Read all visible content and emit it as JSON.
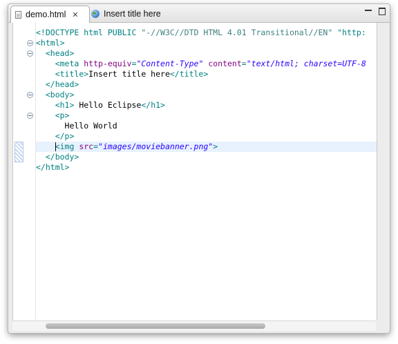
{
  "tabs": [
    {
      "label": "demo.html",
      "icon": "html-file-icon",
      "active": true,
      "close_icon": "close-icon"
    },
    {
      "label": "Insert title here",
      "icon": "globe-icon",
      "active": false
    }
  ],
  "window_controls": [
    "minimize-icon",
    "maximize-icon"
  ],
  "editor": {
    "lines": [
      {
        "segments": [
          [
            "doctype",
            "<!DOCTYPE html PUBLIC "
          ],
          [
            "dtstr",
            "\"-//W3C//DTD HTML 4.01 Transitional//EN\""
          ],
          [
            "doctype",
            " \"http:"
          ]
        ]
      },
      {
        "segments": [
          [
            "tag",
            "<html>"
          ]
        ],
        "fold": true
      },
      {
        "segments": [
          [
            "t",
            "  "
          ],
          [
            "tag",
            "<head>"
          ]
        ],
        "fold": true
      },
      {
        "segments": [
          [
            "t",
            "    "
          ],
          [
            "tag",
            "<meta "
          ],
          [
            "attr",
            "http-equiv"
          ],
          [
            "tag",
            "="
          ],
          [
            "val",
            "\"Content-Type\""
          ],
          [
            "t",
            " "
          ],
          [
            "attr",
            "content"
          ],
          [
            "tag",
            "="
          ],
          [
            "val",
            "\"text/html; charset=UTF-8"
          ]
        ]
      },
      {
        "segments": [
          [
            "t",
            "    "
          ],
          [
            "tag",
            "<title>"
          ],
          [
            "t",
            "Insert title here"
          ],
          [
            "tag",
            "</title>"
          ]
        ]
      },
      {
        "segments": [
          [
            "t",
            "  "
          ],
          [
            "tag",
            "</head>"
          ]
        ]
      },
      {
        "segments": [
          [
            "t",
            "  "
          ],
          [
            "tag",
            "<body>"
          ]
        ],
        "fold": true
      },
      {
        "segments": [
          [
            "t",
            "    "
          ],
          [
            "tag",
            "<h1>"
          ],
          [
            "t",
            " Hello Eclipse"
          ],
          [
            "tag",
            "</h1>"
          ]
        ]
      },
      {
        "segments": [
          [
            "t",
            "    "
          ],
          [
            "tag",
            "<p>"
          ]
        ],
        "fold": true
      },
      {
        "segments": [
          [
            "t",
            "      Hello World"
          ]
        ]
      },
      {
        "segments": [
          [
            "t",
            "    "
          ],
          [
            "tag",
            "</p>"
          ]
        ]
      },
      {
        "segments": [
          [
            "t",
            "    "
          ],
          [
            "tag",
            "<img "
          ],
          [
            "attr",
            "src"
          ],
          [
            "tag",
            "="
          ],
          [
            "val",
            "\"images/moviebanner.png\""
          ],
          [
            "tag",
            ">"
          ]
        ],
        "current": true
      },
      {
        "segments": [
          [
            "t",
            "  "
          ],
          [
            "tag",
            "</body>"
          ]
        ]
      },
      {
        "segments": [
          [
            "tag",
            "</html>"
          ]
        ]
      }
    ]
  }
}
